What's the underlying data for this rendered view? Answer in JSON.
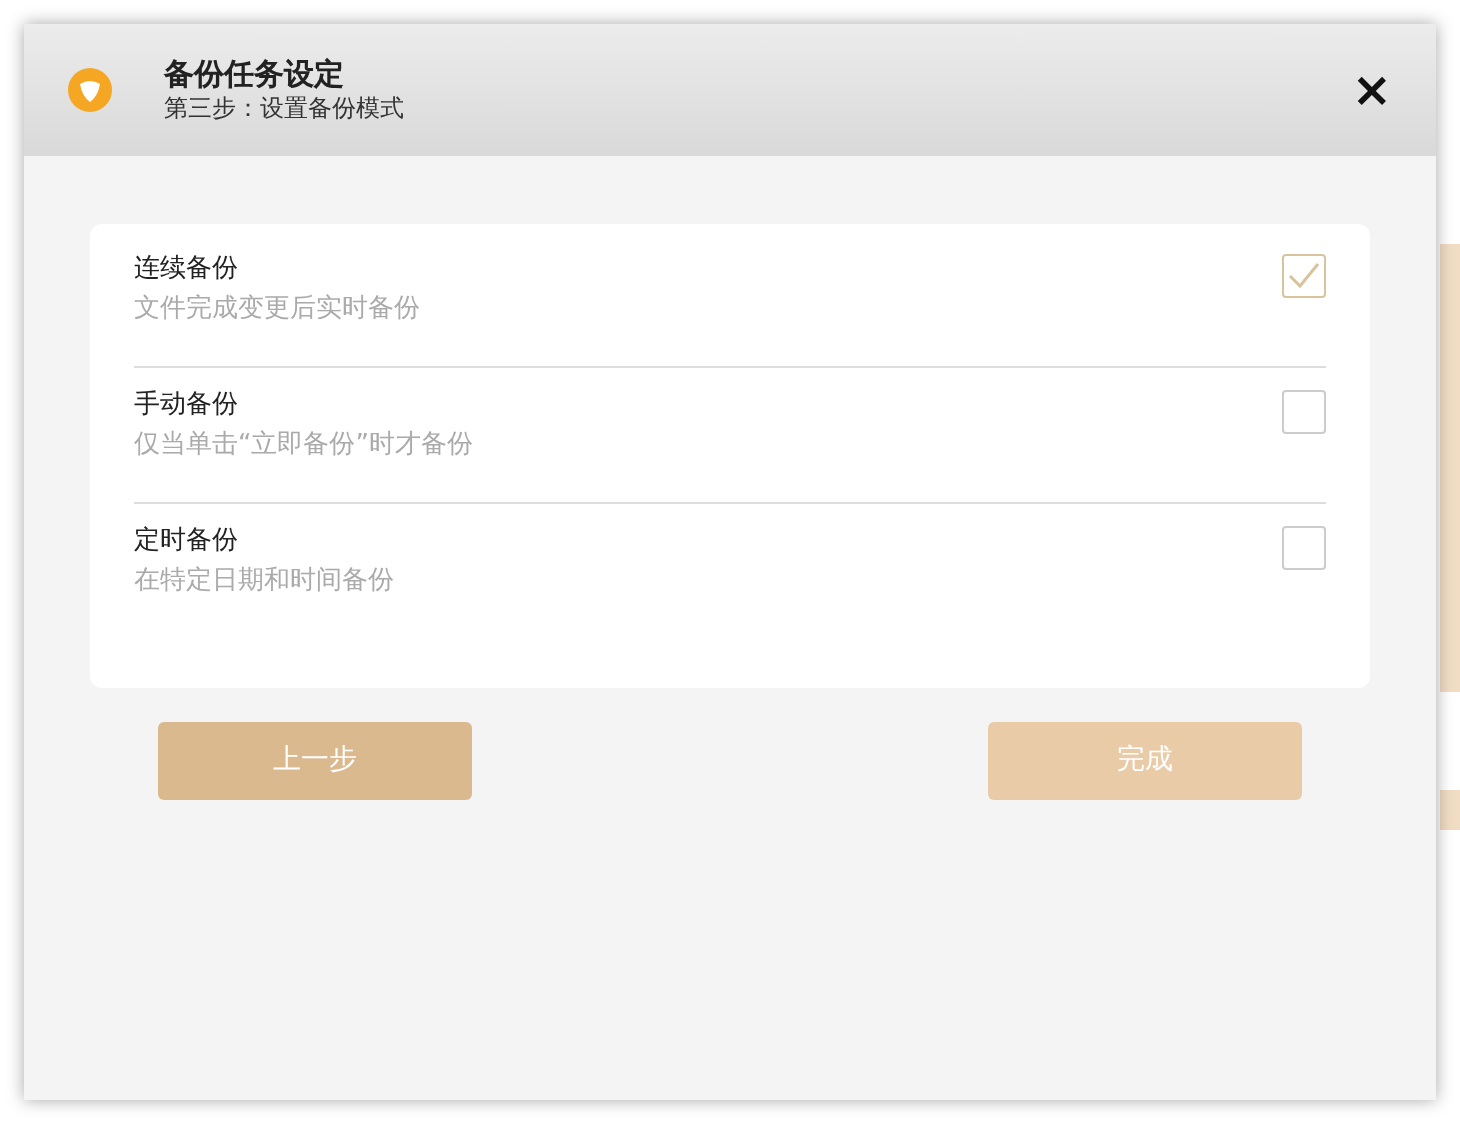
{
  "dialog": {
    "title": "备份任务设定",
    "subtitle": "第三步：设置备份模式",
    "close": "×"
  },
  "options": [
    {
      "label": "连续备份",
      "description": "文件完成变更后实时备份",
      "checked": true
    },
    {
      "label": "手动备份",
      "description": "仅当单击“立即备份”时才备份",
      "checked": false
    },
    {
      "label": "定时备份",
      "description": "在特定日期和时间备份",
      "checked": false
    }
  ],
  "buttons": [
    {
      "label": "上一步",
      "disabled": false
    },
    {
      "label": "完成",
      "disabled": true
    }
  ]
}
